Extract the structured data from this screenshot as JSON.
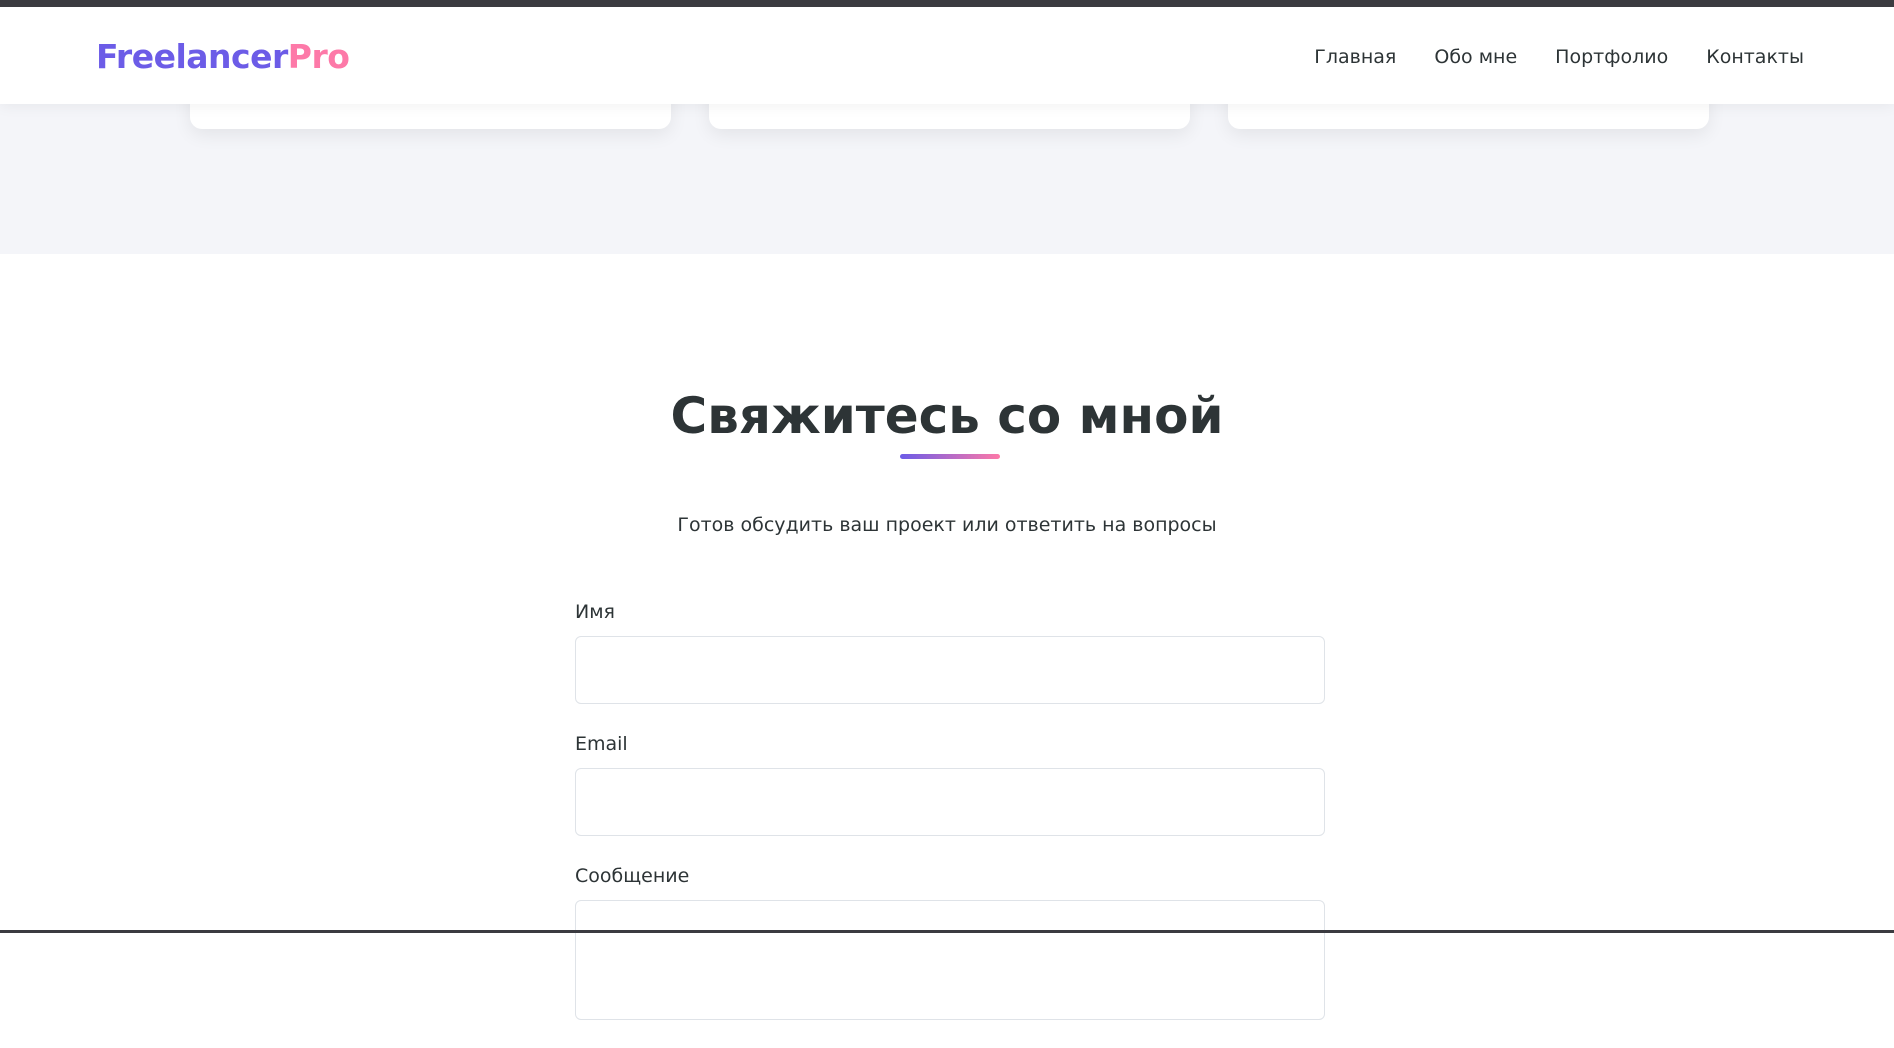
{
  "header": {
    "logo_part1": "Freelancer",
    "logo_part2": "Pro",
    "nav": [
      {
        "label": "Главная"
      },
      {
        "label": "Обо мне"
      },
      {
        "label": "Портфолио"
      },
      {
        "label": "Контакты"
      }
    ]
  },
  "contact": {
    "title": "Свяжитесь со мной",
    "subtitle": "Готов обсудить ваш проект или ответить на вопросы",
    "fields": [
      {
        "label": "Имя",
        "value": ""
      },
      {
        "label": "Email",
        "value": ""
      },
      {
        "label": "Сообщение",
        "value": ""
      }
    ]
  },
  "colors": {
    "brand_primary": "#6c5ce7",
    "brand_secondary": "#fd79a8",
    "text": "#2d3436",
    "section_bg": "#f4f5f9"
  }
}
